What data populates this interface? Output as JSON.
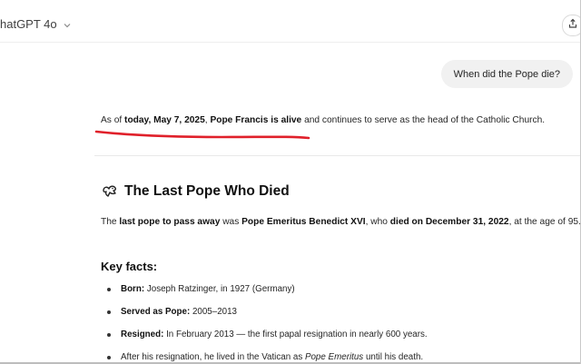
{
  "header": {
    "model_label": "hatGPT 4o",
    "model_chevron_icon": "chevron-down-icon",
    "share_icon": "share-icon"
  },
  "conversation": {
    "user_message": "When did the Pope die?",
    "answer": {
      "prefix": "As of ",
      "date_bold": "today, May 7, 2025",
      "comma": ", ",
      "alive_bold": "Pope Francis is alive",
      "suffix": " and continues to serve as the head of the Catholic Church."
    },
    "annotation_color": "#e0202a",
    "section": {
      "icon": "dove-icon",
      "heading": "The Last Pope Who Died",
      "para": {
        "t1": "The ",
        "b1": "last pope to pass away",
        "t2": " was ",
        "b2": "Pope Emeritus Benedict XVI",
        "t3": ", who ",
        "b3": "died on December 31, 2022",
        "t4": ", at the age of 95."
      },
      "key_facts_heading": "Key facts:",
      "facts": [
        {
          "label": "Born:",
          "text": " Joseph Ratzinger, in 1927 (Germany)"
        },
        {
          "label": "Served as Pope:",
          "text": " 2005–2013"
        },
        {
          "label": "Resigned:",
          "text": " In February 2013 — the first papal resignation in nearly 600 years."
        },
        {
          "pre": "After his resignation, he lived in the Vatican as ",
          "italic": "Pope Emeritus",
          "post": " until his death."
        }
      ]
    }
  }
}
